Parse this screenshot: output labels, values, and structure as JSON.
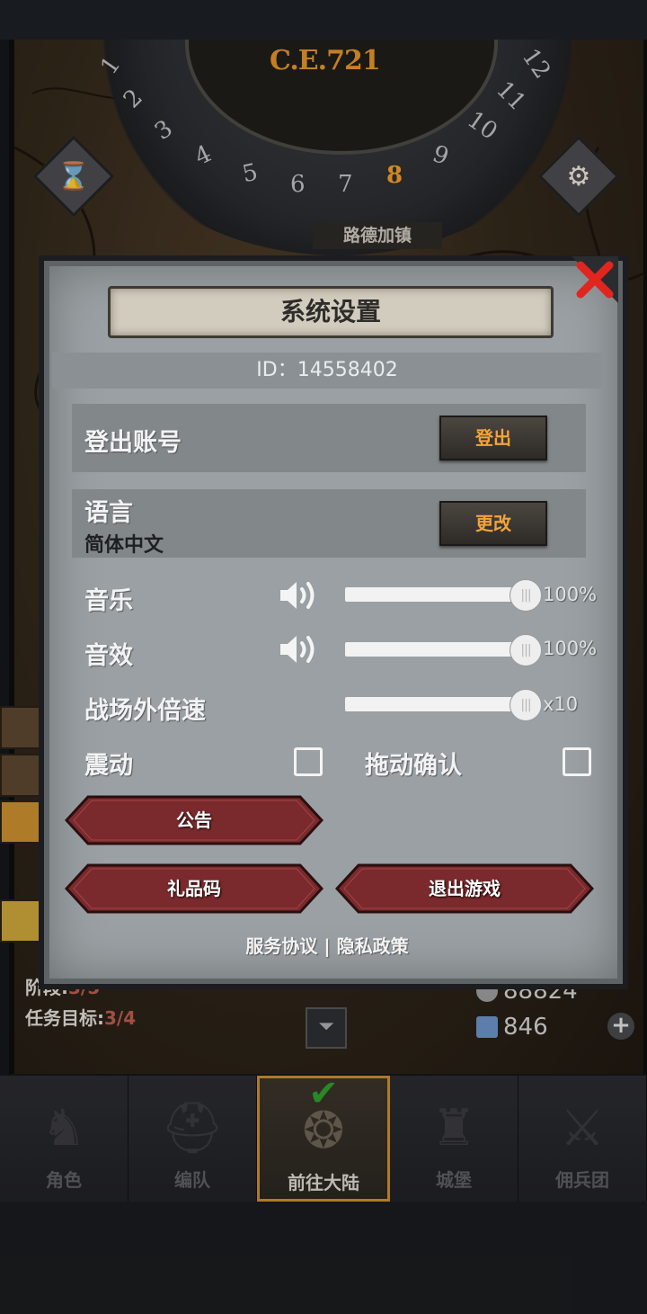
{
  "hud": {
    "year": "C.E.721",
    "dial_numbers": [
      "1",
      "2",
      "3",
      "4",
      "5",
      "6",
      "7",
      "8",
      "9",
      "10",
      "11",
      "12"
    ],
    "active_hour": "8",
    "town_name": "路德加镇",
    "task_stage_label": "阶段:",
    "task_stage_value": "3/5",
    "task_goal_label": "任务目标:",
    "task_goal_value": "3/4",
    "silver": "88824",
    "crystals": "846",
    "plus_symbol": "+",
    "collapse_symbol": "⏷"
  },
  "dialog": {
    "title": "系统设置",
    "id_text": "ID：14558402",
    "logout": {
      "label": "登出账号",
      "button": "登出"
    },
    "language": {
      "label": "语言",
      "current": "简体中文",
      "button": "更改"
    },
    "music": {
      "label": "音乐",
      "value_text": "100%",
      "level": 100
    },
    "sfx": {
      "label": "音效",
      "value_text": "100%",
      "level": 100
    },
    "speed": {
      "label": "战场外倍速",
      "value_text": "x10",
      "level": 100
    },
    "vibration": {
      "label": "震动",
      "checked": false
    },
    "drag_confirm": {
      "label": "拖动确认",
      "checked": false
    },
    "notice_button": "公告",
    "gift_code_button": "礼品码",
    "exit_button": "退出游戏",
    "service_link": "服务协议",
    "separator": "|",
    "privacy_link": "隐私政策"
  },
  "nav": [
    {
      "label": "角色",
      "icon": "knight-icon"
    },
    {
      "label": "编队",
      "icon": "helmet-icon"
    },
    {
      "label": "前往大陆",
      "icon": "globe-icon",
      "active": true
    },
    {
      "label": "城堡",
      "icon": "castle-icon"
    },
    {
      "label": "佣兵团",
      "icon": "mercenary-icon"
    }
  ],
  "colors": {
    "accent_orange": "#f2a43a",
    "panel": "#9aa0a3",
    "red_button": "#7a2a2c",
    "close_red": "#e0261f"
  }
}
